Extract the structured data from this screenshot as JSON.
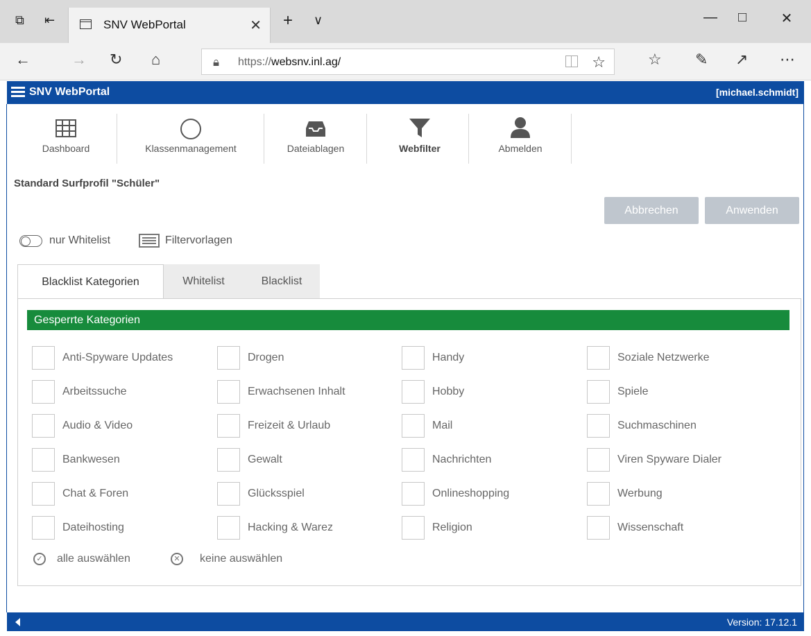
{
  "browser": {
    "tab_title": "SNV WebPortal",
    "url_prefix": "https://",
    "url_host": "websnv.inl.ag/",
    "icons": [
      "tab-preview-icon",
      "set-aside-tabs-icon",
      "page-icon",
      "close-icon",
      "new-tab-icon",
      "tab-list-icon",
      "minimize-icon",
      "maximize-icon",
      "close-window-icon",
      "back-icon",
      "forward-icon",
      "refresh-icon",
      "home-icon",
      "lock-icon",
      "reading-view-icon",
      "favorite-star-icon",
      "favorites-hub-icon",
      "pen-icon",
      "share-icon",
      "more-icon"
    ]
  },
  "header": {
    "title": "SNV WebPortal",
    "user": "[michael.schmidt]"
  },
  "nav": {
    "items": [
      {
        "label": "Dashboard",
        "icon": "grid-icon"
      },
      {
        "label": "Klassenmanagement",
        "icon": "circle-icon"
      },
      {
        "label": "Dateiablagen",
        "icon": "inbox-icon"
      },
      {
        "label": "Webfilter",
        "icon": "filter-icon",
        "active": true
      },
      {
        "label": "Abmelden",
        "icon": "user-icon"
      }
    ]
  },
  "page": {
    "title": "Standard Surfprofil \"Schüler\"",
    "cancel_label": "Abbrechen",
    "apply_label": "Anwenden",
    "whitelist_only_label": "nur Whitelist",
    "filter_templates_label": "Filtervorlagen"
  },
  "tabs": [
    {
      "label": "Blacklist Kategorien",
      "active": true
    },
    {
      "label": "Whitelist"
    },
    {
      "label": "Blacklist"
    }
  ],
  "categories": {
    "header": "Gesperrte Kategorien",
    "columns": [
      [
        "Anti-Spyware Updates",
        "Arbeitssuche",
        "Audio & Video",
        "Bankwesen",
        "Chat & Foren",
        "Dateihosting"
      ],
      [
        "Drogen",
        "Erwachsenen Inhalt",
        "Freizeit & Urlaub",
        "Gewalt",
        "Glücksspiel",
        "Hacking & Warez"
      ],
      [
        "Handy",
        "Hobby",
        "Mail",
        "Nachrichten",
        "Onlineshopping",
        "Religion"
      ],
      [
        "Soziale Netzwerke",
        "Spiele",
        "Suchmaschinen",
        "Viren Spyware Dialer",
        "Werbung",
        "Wissenschaft"
      ]
    ],
    "select_all": "alle auswählen",
    "select_none": "keine auswählen"
  },
  "footer": {
    "version": "Version: 17.12.1"
  },
  "colors": {
    "header_blue": "#0d4ca1",
    "category_green": "#178b3c",
    "disabled_button": "#bfc6ce"
  }
}
